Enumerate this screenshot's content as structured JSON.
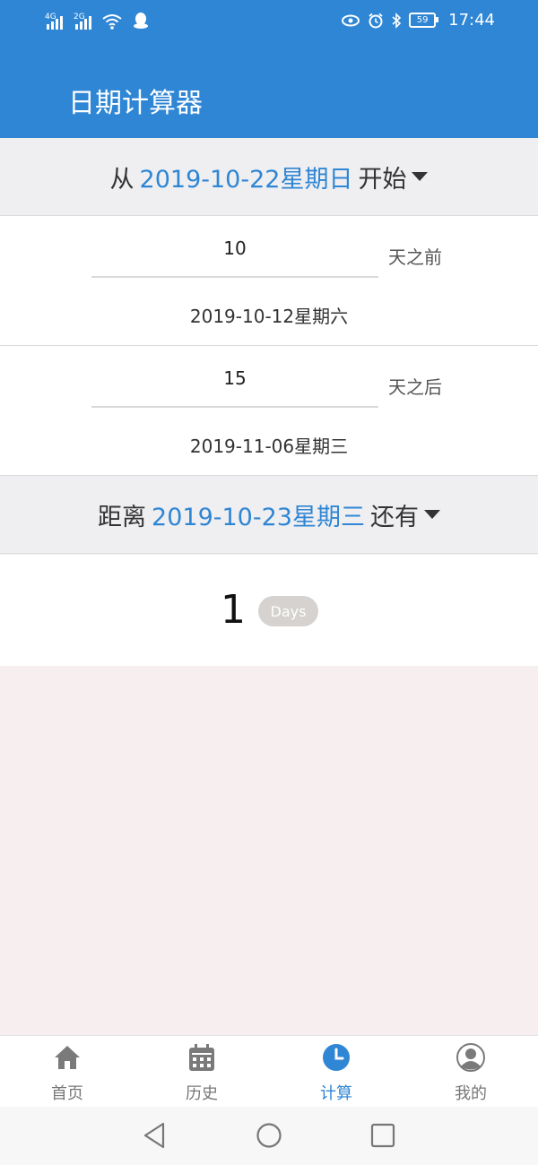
{
  "status_bar": {
    "net1": "4G",
    "net2": "2G",
    "battery": "59",
    "time": "17:44",
    "icons": [
      "signal-icon",
      "signal-icon",
      "wifi-icon",
      "qq-icon",
      "eye-icon",
      "alarm-icon",
      "bluetooth-icon",
      "battery-icon"
    ]
  },
  "app": {
    "title": "日期计算器"
  },
  "start": {
    "prefix": "从",
    "date": "2019-10-22星期日",
    "suffix": "开始"
  },
  "before": {
    "value": "10",
    "unit": "天之前",
    "result": "2019-10-12星期六"
  },
  "after": {
    "value": "15",
    "unit": "天之后",
    "result": "2019-11-06星期三"
  },
  "distance": {
    "prefix": "距离",
    "date": "2019-10-23星期三",
    "suffix": "还有",
    "count": "1",
    "unit": "Days"
  },
  "nav": {
    "items": [
      {
        "label": "首页",
        "icon": "home-icon"
      },
      {
        "label": "历史",
        "icon": "calendar-icon"
      },
      {
        "label": "计算",
        "icon": "clock-icon"
      },
      {
        "label": "我的",
        "icon": "user-icon"
      }
    ],
    "active": "计算"
  },
  "colors": {
    "primary": "#2f86d4",
    "background": "#f6eeef",
    "header_bg": "#efeff2",
    "pill_bg": "#d5d2cf"
  }
}
